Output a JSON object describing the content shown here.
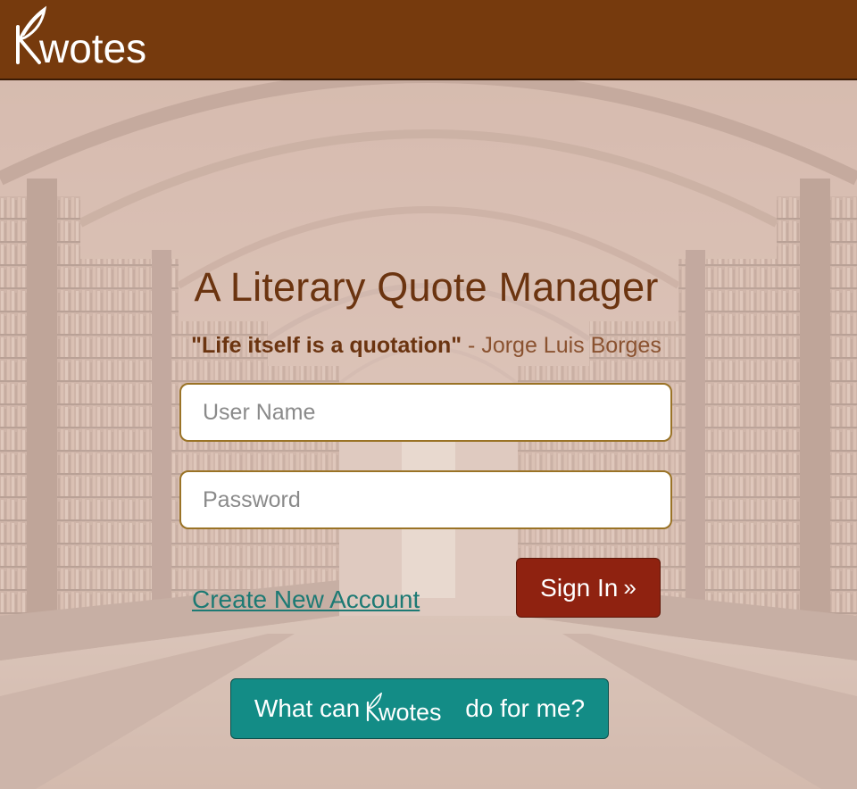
{
  "header": {
    "brand_name": "Kwotes",
    "background_color": "#763a0d"
  },
  "main": {
    "title": "A Literary Quote Manager",
    "tagline": {
      "quote": "\"Life itself is a quotation\"",
      "separator": "-",
      "author": "Jorge Luis Borges"
    }
  },
  "login_form": {
    "username_placeholder": "User Name",
    "password_placeholder": "Password",
    "create_account_label": "Create New Account",
    "sign_in_label": "Sign In",
    "sign_in_icon": "double-chevron-right-icon"
  },
  "about_button": {
    "prefix": "What can",
    "brand": "Kwotes",
    "suffix": "do for me?"
  },
  "colors": {
    "accent_brown": "#6b3410",
    "sign_in_red": "#8f2210",
    "teal": "#138c86",
    "input_border": "#9a7326"
  }
}
